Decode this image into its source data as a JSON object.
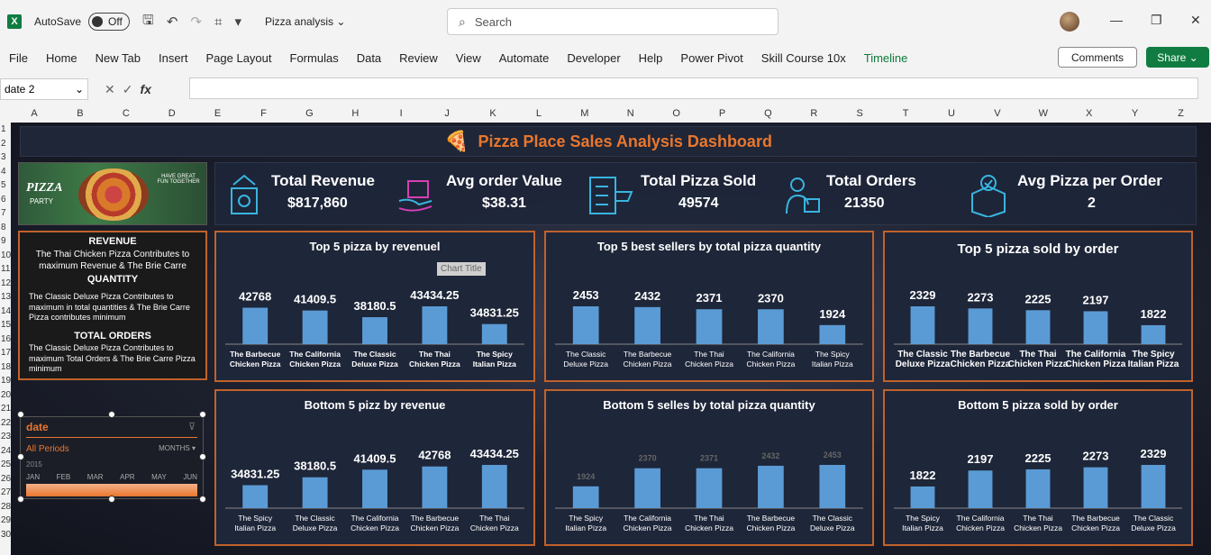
{
  "app": {
    "logo_letter": "X",
    "autosave_label": "AutoSave",
    "autosave_state": "Off",
    "doc_title": "Pizza analysis",
    "search_placeholder": "Search"
  },
  "menu": [
    "File",
    "Home",
    "New Tab",
    "Insert",
    "Page Layout",
    "Formulas",
    "Data",
    "Review",
    "View",
    "Automate",
    "Developer",
    "Help",
    "Power Pivot",
    "Skill Course 10x",
    "Timeline"
  ],
  "buttons": {
    "comments": "Comments",
    "share": "Share"
  },
  "formula_bar": {
    "name_box": "date 2",
    "fx": "fx",
    "value": ""
  },
  "columns": [
    "A",
    "B",
    "C",
    "D",
    "E",
    "F",
    "G",
    "H",
    "I",
    "J",
    "K",
    "L",
    "M",
    "N",
    "O",
    "P",
    "Q",
    "R",
    "S",
    "T",
    "U",
    "V",
    "W",
    "X",
    "Y",
    "Z"
  ],
  "rows": [
    "1",
    "2",
    "3",
    "4",
    "5",
    "6",
    "7",
    "8",
    "9",
    "10",
    "11",
    "12",
    "13",
    "14",
    "15",
    "16",
    "17",
    "18",
    "19",
    "20",
    "21",
    "22",
    "23",
    "24",
    "25",
    "26",
    "27",
    "28",
    "29",
    "30"
  ],
  "dashboard": {
    "title": "Pizza Place Sales Analysis Dashboard",
    "banner": {
      "title": "PIZZA",
      "subtitle": "PARTY",
      "tagline": "HAVE GREAT FUN TOGETHER"
    },
    "kpis": [
      {
        "label": "Total Revenue",
        "value": "$817,860"
      },
      {
        "label": "Avg order Value",
        "value": "$38.31"
      },
      {
        "label": "Total Pizza Sold",
        "value": "49574"
      },
      {
        "label": "Total Orders",
        "value": "21350"
      },
      {
        "label": "Avg Pizza per Order",
        "value": "2"
      }
    ],
    "notes": [
      {
        "heading": "REVENUE",
        "text": "The Thai Chicken Pizza Contributes to maximum Revenue & The Brie Carre"
      },
      {
        "heading": "QUANTITY",
        "text": "The Classic Deluxe Pizza Contributes to maximum in total quantities & The  Brie Carre Pizza contributes minimum"
      },
      {
        "heading": "TOTAL ORDERS",
        "text": "The Classic Deluxe Pizza Contributes to maximum Total Orders & The Brie Carre Pizza minimum"
      }
    ],
    "timeline": {
      "header": "date",
      "all_periods": "All Periods",
      "months": "MONTHS",
      "year": "2015",
      "month_labels": [
        "JAN",
        "FEB",
        "MAR",
        "APR",
        "MAY",
        "JUN"
      ]
    },
    "tooltip": "Chart Title"
  },
  "chart_data": [
    {
      "type": "bar",
      "title": "Top 5 pizza by revenuel",
      "categories": [
        "The Barbecue Chicken Pizza",
        "The California Chicken Pizza",
        "The Classic Deluxe Pizza",
        "The Thai Chicken Pizza",
        "The Spicy Italian Pizza"
      ],
      "values": [
        42768,
        41409.5,
        38180.5,
        43434.25,
        34831.25
      ],
      "labels": [
        "42768",
        "41409.5",
        "38180.5",
        "43434.25",
        "34831.25"
      ]
    },
    {
      "type": "bar",
      "title": "Top 5 best sellers by total pizza quantity",
      "categories": [
        "The Classic Deluxe Pizza",
        "The Barbecue Chicken Pizza",
        "The Thai Chicken Pizza",
        "The California Chicken Pizza",
        "The Spicy Italian Pizza"
      ],
      "values": [
        2453,
        2432,
        2371,
        2370,
        1924
      ],
      "labels": [
        "2453",
        "2432",
        "2371",
        "2370",
        "1924"
      ]
    },
    {
      "type": "bar",
      "title": "Top 5 pizza sold by order",
      "categories": [
        "The Classic Deluxe Pizza",
        "The Barbecue Chicken Pizza",
        "The Thai Chicken Pizza",
        "The California Chicken Pizza",
        "The Spicy Italian Pizza"
      ],
      "values": [
        2329,
        2273,
        2225,
        2197,
        1822
      ],
      "labels": [
        "2329",
        "2273",
        "2225",
        "2197",
        "1822"
      ]
    },
    {
      "type": "bar",
      "title": "Bottom 5 pizz by revenue",
      "categories": [
        "The Spicy Italian Pizza",
        "The Classic Deluxe Pizza",
        "The California Chicken Pizza",
        "The Barbecue Chicken Pizza",
        "The Thai Chicken Pizza"
      ],
      "values": [
        34831.25,
        38180.5,
        41409.5,
        42768,
        43434.25
      ],
      "labels": [
        "34831.25",
        "38180.5",
        "41409.5",
        "42768",
        "43434.25"
      ]
    },
    {
      "type": "bar",
      "title": "Bottom 5 selles by total pizza quantity",
      "categories": [
        "The Spicy Italian Pizza",
        "The California Chicken Pizza",
        "The Thai Chicken Pizza",
        "The Barbecue Chicken Pizza",
        "The Classic Deluxe Pizza"
      ],
      "values": [
        1924,
        2370,
        2371,
        2432,
        2453
      ],
      "labels": [
        "1924",
        "2370",
        "2371",
        "2432",
        "2453"
      ]
    },
    {
      "type": "bar",
      "title": "Bottom 5 pizza sold by order",
      "categories": [
        "The Spicy Italian Pizza",
        "The California Chicken Pizza",
        "The Thai Chicken Pizza",
        "The Barbecue Chicken Pizza",
        "The Classic Deluxe Pizza"
      ],
      "values": [
        1822,
        2197,
        2225,
        2273,
        2329
      ],
      "labels": [
        "1822",
        "2197",
        "2225",
        "2273",
        "2329"
      ]
    }
  ],
  "colors": {
    "bar": "#5b9bd5",
    "accent": "#e8772e",
    "panel": "#1e2639",
    "border": "#c0622b",
    "excel_green": "#107c41"
  }
}
